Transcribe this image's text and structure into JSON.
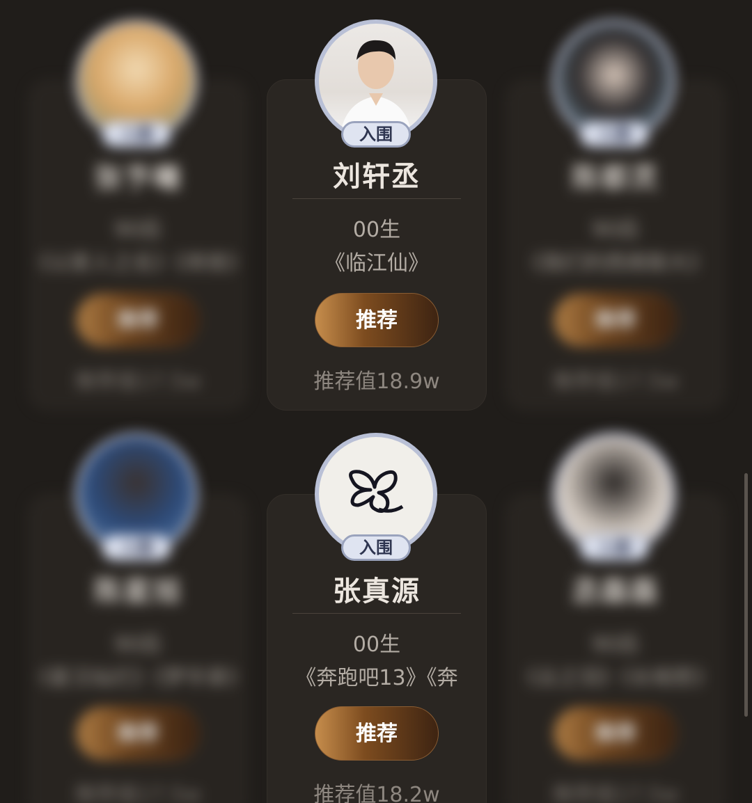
{
  "cards": [
    {
      "name": "张予曦",
      "birth": "90后",
      "works": "《以家人之名》《将夜》",
      "badge": "入围",
      "button": "推荐",
      "score": "推荐值17.5w",
      "blurred": true
    },
    {
      "name": "刘轩丞",
      "birth": "00生",
      "works": "《临江仙》",
      "badge": "入围",
      "button": "推荐",
      "score": "推荐值18.9w",
      "blurred": false
    },
    {
      "name": "陈都灵",
      "birth": "90后",
      "works": "《我们的西南联大》",
      "badge": "入围",
      "button": "推荐",
      "score": "推荐值17.5w",
      "blurred": true
    },
    {
      "name": "陈星旭",
      "birth": "90后",
      "works": "《星汉灿烂》《梦华录》",
      "badge": "入围",
      "button": "推荐",
      "score": "推荐值17.5w",
      "blurred": true
    },
    {
      "name": "张真源",
      "birth": "00生",
      "works": "《奔跑吧13》《奔",
      "badge": "入围",
      "button": "推荐",
      "score": "推荐值18.2w",
      "blurred": false
    },
    {
      "name": "丞磊磊",
      "birth": "90后",
      "works": "《云之羽》《长相思》",
      "badge": "入围",
      "button": "推荐",
      "score": "推荐值17.5w",
      "blurred": true
    }
  ],
  "colors": {
    "background": "#201d1a",
    "card": "#2a2622",
    "button_gradient_start": "#c68d4c",
    "button_gradient_end": "#3e2412",
    "badge": "#dfe4f1"
  }
}
